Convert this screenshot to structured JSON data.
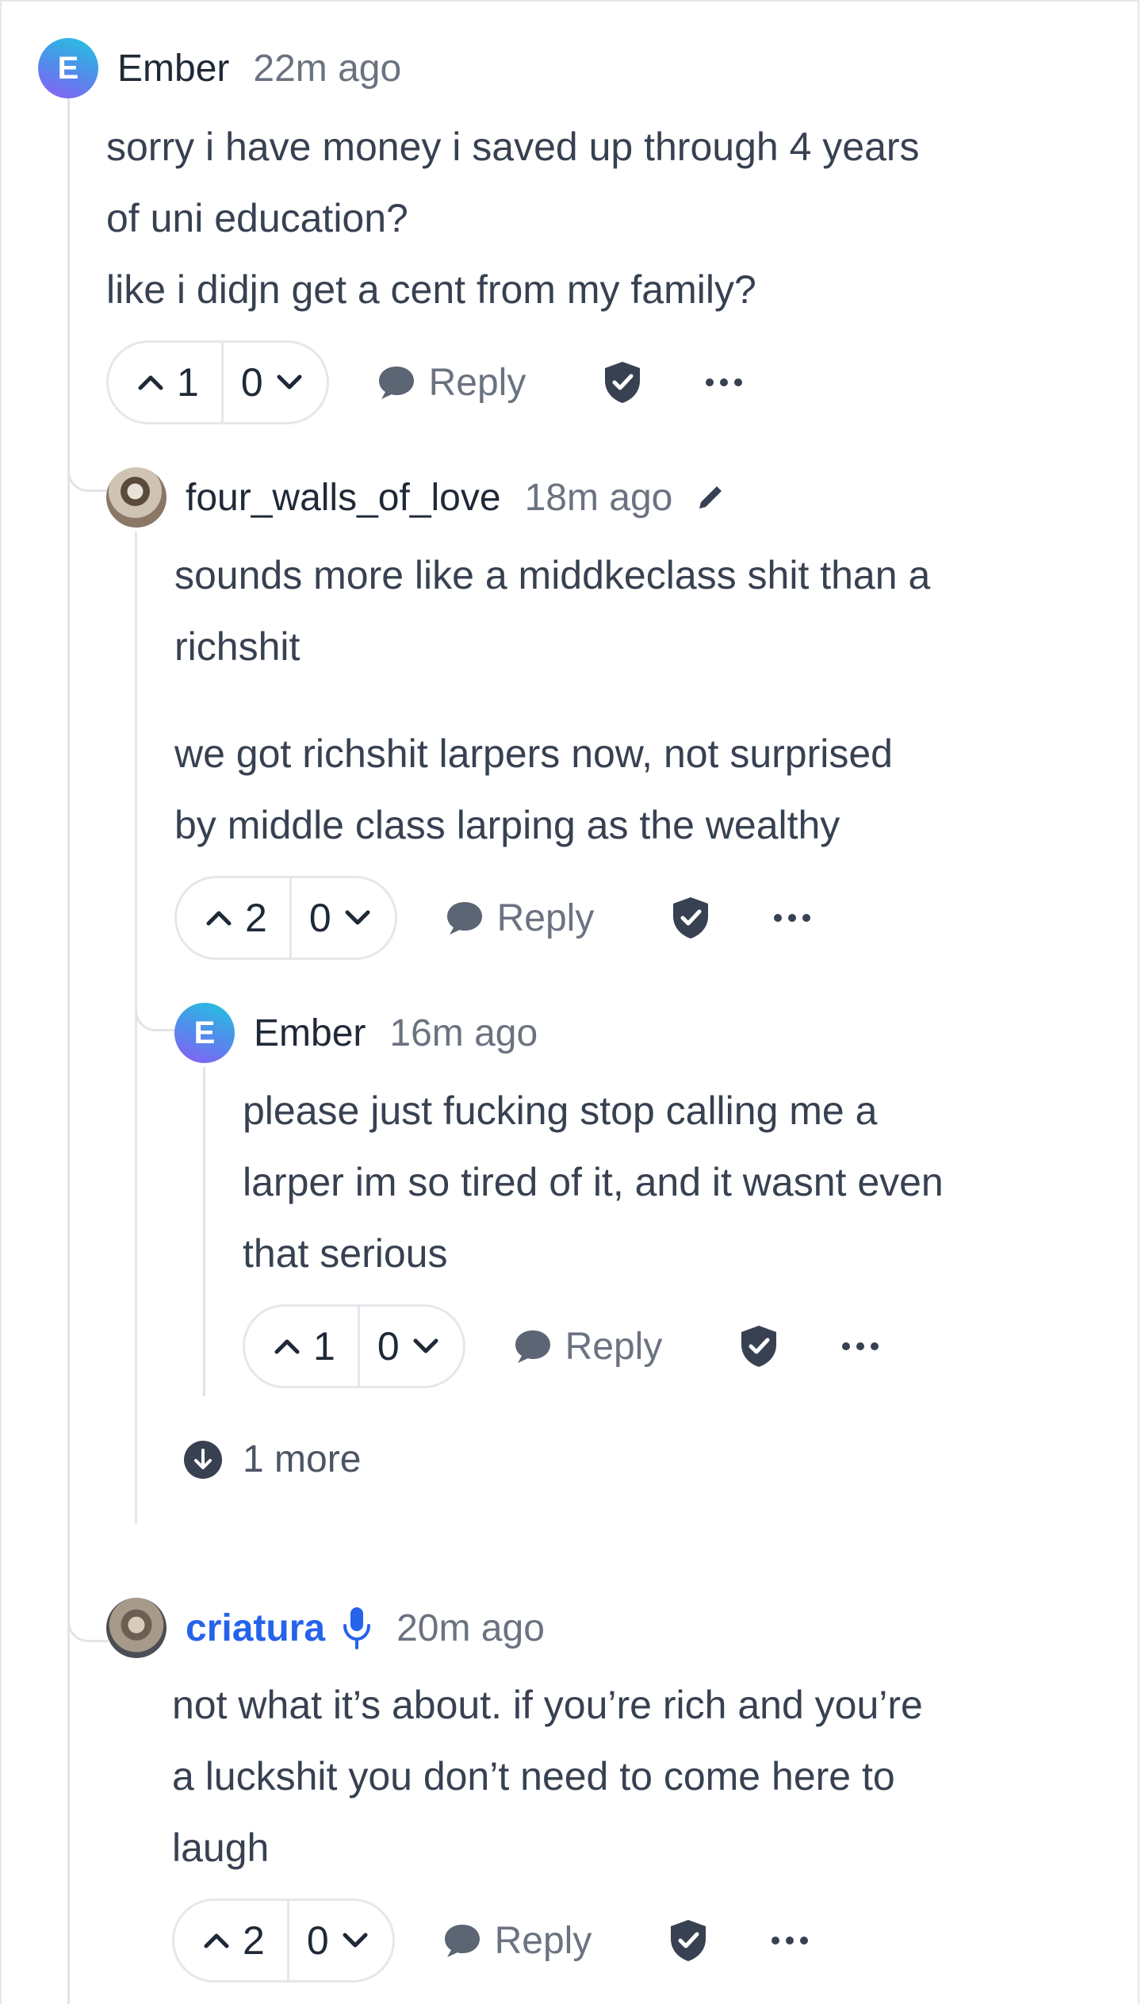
{
  "colors": {
    "link_author": "#2563eb",
    "text": "#374151",
    "muted": "#6b7280",
    "thread_line": "#e2e4e8"
  },
  "comments": [
    {
      "author": "Ember",
      "avatar_letter": "E",
      "time": "22m ago",
      "lines": [
        "sorry i have money i saved up through 4 years",
        "of uni education?",
        "like i didjn  get a cent from my family?"
      ],
      "upvotes": "1",
      "downvotes": "0",
      "reply_label": "Reply"
    },
    {
      "author": "four_walls_of_love",
      "time": "18m ago",
      "icon": "pencil-icon",
      "paragraphs": [
        [
          "sounds more like a middkeclass shit than a",
          "richshit"
        ],
        [
          "we got richshit larpers now, not surprised",
          "by middle class larping as the wealthy"
        ]
      ],
      "upvotes": "2",
      "downvotes": "0",
      "reply_label": "Reply"
    },
    {
      "author": "Ember",
      "avatar_letter": "E",
      "time": "16m ago",
      "lines": [
        "please just fucking stop calling me a",
        "larper im so tired of it, and it wasnt even",
        "that serious"
      ],
      "upvotes": "1",
      "downvotes": "0",
      "reply_label": "Reply"
    },
    {
      "author": "criatura",
      "time": "20m ago",
      "icon": "microphone-icon",
      "lines": [
        "not what it’s about. if you’re rich and you’re",
        "a luckshit you don’t need to come here to",
        "laugh"
      ],
      "upvotes": "2",
      "downvotes": "0",
      "reply_label": "Reply"
    }
  ],
  "show_more": {
    "label": "1 more"
  }
}
